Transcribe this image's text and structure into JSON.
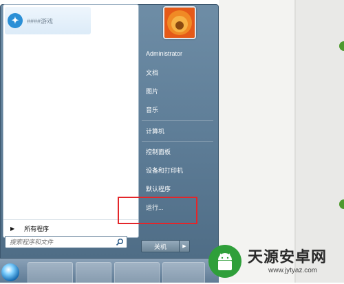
{
  "start_menu": {
    "pinned_app_label": "####游戏",
    "all_programs": "所有程序",
    "search_placeholder": "搜索程序和文件",
    "user_name": "Administrator",
    "right_items": [
      "文档",
      "图片",
      "音乐",
      "计算机",
      "控制面板",
      "设备和打印机",
      "默认程序",
      "运行..."
    ],
    "shutdown_label": "关机"
  },
  "watermark": {
    "brand": "天源安卓网",
    "url": "www.jytyaz.com"
  },
  "colors": {
    "highlight_box": "#e3262a",
    "menu_panel": "#5d7c96",
    "green_marker": "#4e9a2e"
  },
  "icons": [
    "start-orb-icon",
    "search-icon",
    "chevron-right-icon",
    "user-picture-flower",
    "android-logo-icon"
  ]
}
